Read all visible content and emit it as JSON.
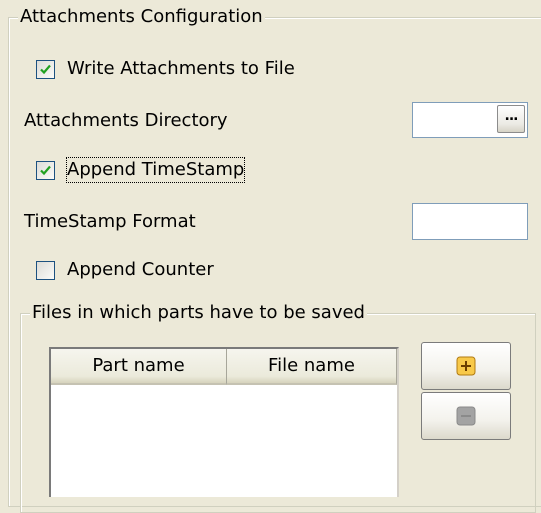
{
  "attachments_config": {
    "legend": "Attachments Configuration",
    "write_attachments": {
      "label": "Write Attachments to File",
      "checked": true
    },
    "attachments_directory": {
      "label": "Attachments Directory",
      "value": "",
      "browse_label": "..."
    },
    "append_timestamp": {
      "label": "Append TimeStamp",
      "checked": true
    },
    "timestamp_format": {
      "label": "TimeStamp Format",
      "value": ""
    },
    "append_counter": {
      "label": "Append Counter",
      "checked": false
    }
  },
  "files_parts": {
    "legend": "Files in which parts have to be saved",
    "columns": [
      "Part name",
      "File name"
    ],
    "rows": [],
    "add_button": {
      "icon": "plus-icon",
      "enabled": true
    },
    "remove_button": {
      "icon": "minus-icon",
      "enabled": false
    }
  },
  "colors": {
    "background": "#ece9d8",
    "checkbox_border": "#1c5180",
    "checkmark": "#21a121",
    "add_icon_fill": "#f8c94a",
    "remove_icon_fill": "#a3a3a3"
  }
}
